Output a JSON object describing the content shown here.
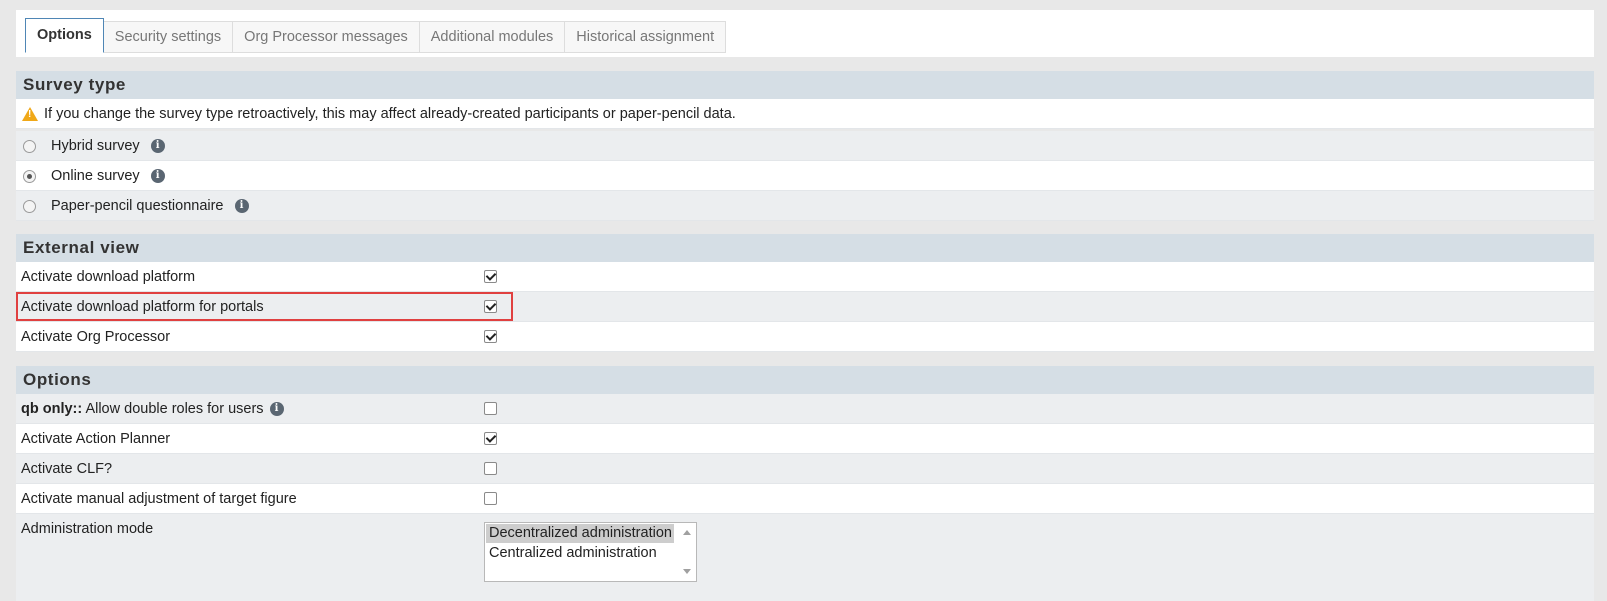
{
  "tabs": [
    {
      "label": "Options",
      "active": true
    },
    {
      "label": "Security settings",
      "active": false
    },
    {
      "label": "Org Processor messages",
      "active": false
    },
    {
      "label": "Additional modules",
      "active": false
    },
    {
      "label": "Historical assignment",
      "active": false
    }
  ],
  "survey_type": {
    "title": "Survey type",
    "warning": "If you change the survey type retroactively, this may affect already-created participants or paper-pencil data.",
    "options": [
      {
        "label": "Hybrid survey",
        "checked": false
      },
      {
        "label": "Online survey",
        "checked": true
      },
      {
        "label": "Paper-pencil questionnaire",
        "checked": false
      }
    ]
  },
  "external_view": {
    "title": "External view",
    "items": [
      {
        "label": "Activate download platform",
        "checked": true
      },
      {
        "label": "Activate download platform for portals",
        "checked": true
      },
      {
        "label": "Activate Org Processor",
        "checked": true
      }
    ]
  },
  "options": {
    "title": "Options",
    "items": [
      {
        "prefix": "qb only::",
        "label": " Allow double roles for users",
        "checked": false
      },
      {
        "label": "Activate Action Planner",
        "checked": true
      },
      {
        "label": "Activate CLF?",
        "checked": false
      },
      {
        "label": "Activate manual adjustment of target figure",
        "checked": false
      }
    ],
    "admin_mode": {
      "label": "Administration mode",
      "choices": [
        "Decentralized administration",
        "Centralized administration"
      ],
      "selected": "Decentralized administration"
    }
  },
  "icons": {
    "warning": "warning-icon",
    "info": "info-icon"
  },
  "colors": {
    "highlight": "#e04040",
    "tab_active_border": "#4f86b5",
    "warning": "#f0a818"
  }
}
